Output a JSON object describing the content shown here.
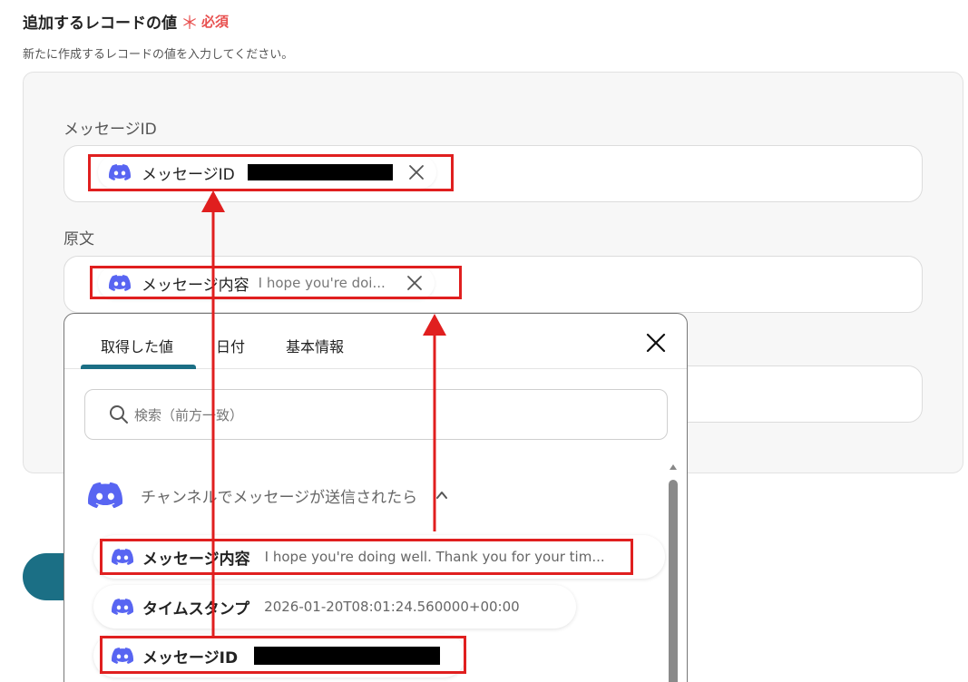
{
  "section": {
    "title": "追加するレコードの値",
    "required_mark": "＊",
    "required_label": "必須",
    "description": "新たに作成するレコードの値を入力してください。"
  },
  "fields": [
    {
      "label": "メッセージID",
      "chip_icon": "discord-icon",
      "chip_name": "メッセージID",
      "chip_value_redacted": true
    },
    {
      "label": "原文",
      "chip_icon": "discord-icon",
      "chip_name": "メッセージ内容",
      "chip_preview": "I hope you're doi..."
    },
    {
      "label": ""
    }
  ],
  "picker": {
    "tabs": [
      {
        "label": "取得した値",
        "active": true
      },
      {
        "label": "日付",
        "active": false
      },
      {
        "label": "基本情報",
        "active": false
      }
    ],
    "search_placeholder": "検索（前方一致）",
    "group_name": "チャンネルでメッセージが送信されたら",
    "items": [
      {
        "name": "メッセージ内容",
        "value": "I hope you're doing well. Thank you for your tim..."
      },
      {
        "name": "タイムスタンプ",
        "value": "2026-01-20T08:01:24.560000+00:00"
      },
      {
        "name": "メッセージID",
        "value_redacted": true
      }
    ]
  },
  "colors": {
    "accent": "#1b6f85",
    "discord": "#5865f2",
    "required": "#e8504f",
    "highlight": "#e01f1f"
  }
}
